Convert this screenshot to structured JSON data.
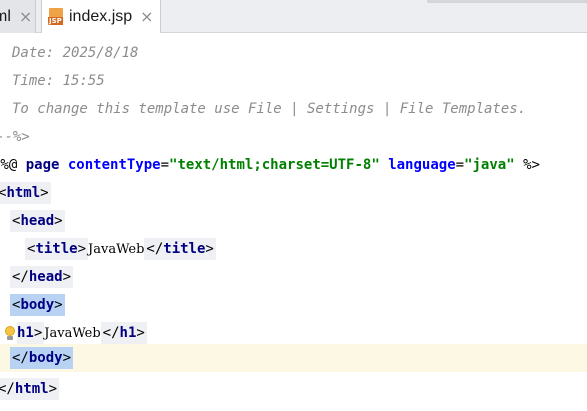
{
  "tabs": [
    {
      "label": "ml",
      "active": false
    },
    {
      "label": "index.jsp",
      "active": true,
      "icon": "jsp-file-icon",
      "badge": "JSP"
    }
  ],
  "close_glyph": "×",
  "comment_lines": [
    "Date: 2025/8/18",
    "Time: 15:55",
    "To change this template use File | Settings | File Templates."
  ],
  "comment_end": "--%>",
  "directive": {
    "open": "<%@ ",
    "keyword": "page",
    "attr1": "contentType",
    "eq": "=",
    "val1": "\"text/html;charset=UTF-8\"",
    "attr2": "language",
    "val2": "\"java\"",
    "close": " %>"
  },
  "tags": {
    "html": "html",
    "head": "head",
    "title": "title",
    "body": "body",
    "h1": "h1"
  },
  "text": {
    "title": "JavaWeb",
    "h1": "JavaWeb"
  }
}
